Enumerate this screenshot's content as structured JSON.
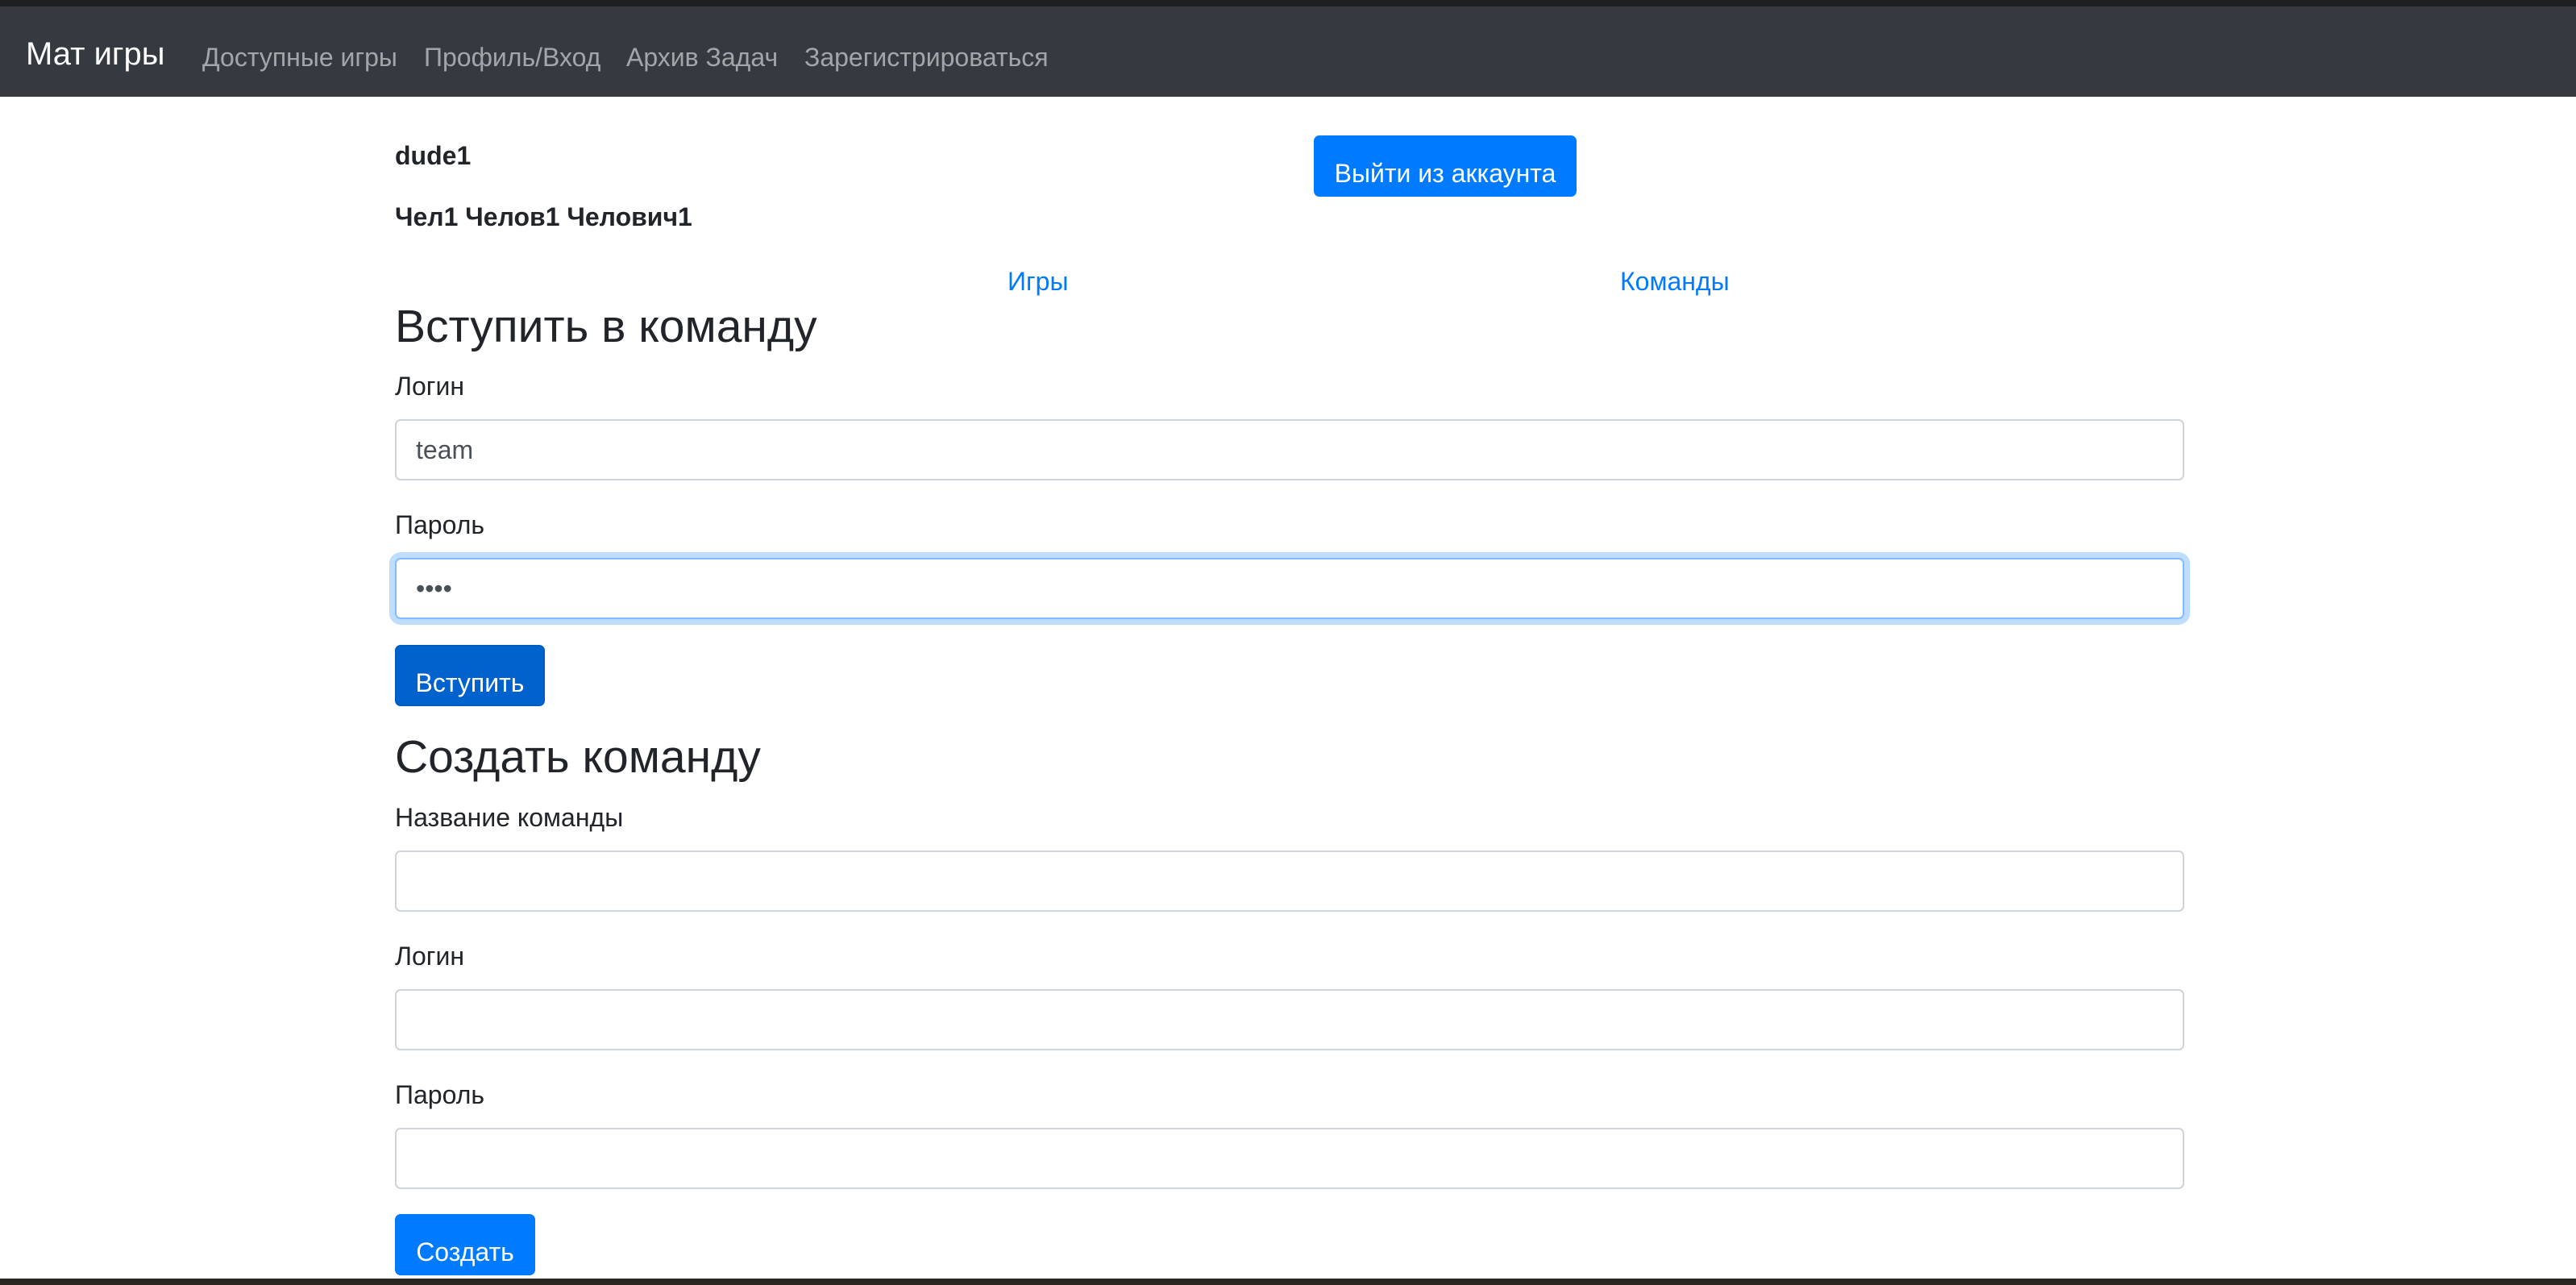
{
  "navbar": {
    "brand": "Мат игры",
    "links": [
      {
        "label": "Доступные игры"
      },
      {
        "label": "Профиль/Вход"
      },
      {
        "label": "Архив Задач"
      },
      {
        "label": "Зарегистрироваться"
      }
    ]
  },
  "profile": {
    "login": "dude1",
    "full_name": "Чел1 Челов1 Челович1",
    "logout_label": "Выйти из аккаунта"
  },
  "profile_tabs": {
    "games": "Игры",
    "teams": "Команды"
  },
  "join_team": {
    "title": "Вступить в команду",
    "login_label": "Логин",
    "login_value": "team",
    "password_label": "Пароль",
    "password_value": "••••",
    "submit_label": "Вступить"
  },
  "create_team": {
    "title": "Создать команду",
    "name_label": "Название команды",
    "name_value": "",
    "login_label": "Логин",
    "login_value": "",
    "password_label": "Пароль",
    "password_value": "",
    "submit_label": "Создать"
  },
  "colors": {
    "navbar_bg": "#343a40",
    "primary": "#007bff",
    "link": "#007bff",
    "text": "#212529"
  }
}
